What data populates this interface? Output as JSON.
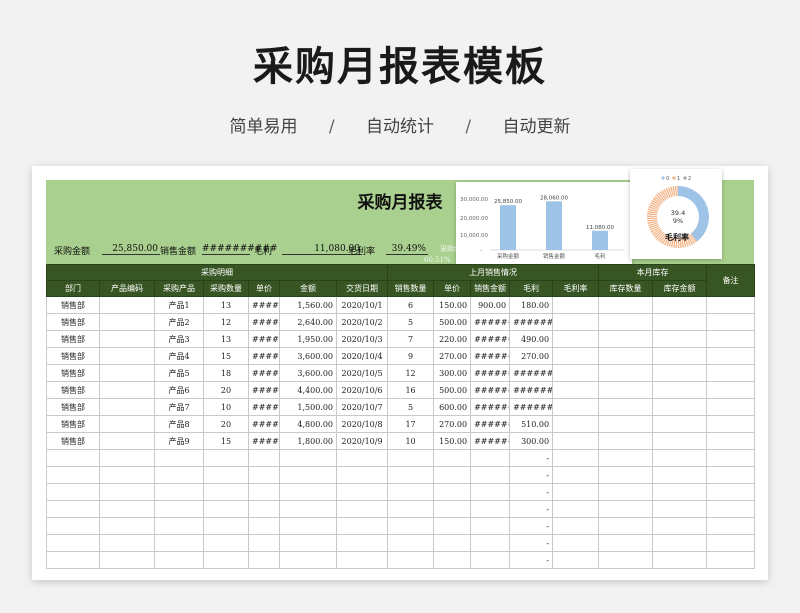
{
  "page": {
    "title": "采购月报表模板",
    "tags": [
      "简单易用",
      "自动统计",
      "自动更新"
    ],
    "separator": "/"
  },
  "sheet": {
    "title": "采购月报表",
    "summary": {
      "purchase_label": "采购金额",
      "purchase_value": "25,850.00",
      "sales_label": "销售金额",
      "sales_value": "##########",
      "profit_label": "毛利",
      "profit_value": "11,080.00",
      "margin_label": "毛利率",
      "margin_value": "39.49%",
      "partial_label": "采购金",
      "partial_value": "60.51%"
    },
    "group_headers": {
      "detail": "采购明细",
      "last_month": "上月销售情况",
      "stock": "本月库存",
      "remark": "备注"
    },
    "columns": [
      "部门",
      "产品编码",
      "采购产品",
      "采购数量",
      "单价",
      "金额",
      "交货日期",
      "销售数量",
      "单价",
      "销售金额",
      "毛利",
      "毛利率",
      "库存数量",
      "库存金额"
    ],
    "rows": [
      [
        "销售部",
        "",
        "产品1",
        "13",
        "######",
        "1,560.00",
        "2020/10/1",
        "6",
        "150.00",
        "900.00",
        "180.00",
        "",
        "",
        ""
      ],
      [
        "销售部",
        "",
        "产品2",
        "12",
        "######",
        "2,640.00",
        "2020/10/2",
        "5",
        "500.00",
        "########",
        "#########",
        "",
        "",
        ""
      ],
      [
        "销售部",
        "",
        "产品3",
        "13",
        "######",
        "1,950.00",
        "2020/10/3",
        "7",
        "220.00",
        "########",
        "490.00",
        "",
        "",
        ""
      ],
      [
        "销售部",
        "",
        "产品4",
        "15",
        "######",
        "3,600.00",
        "2020/10/4",
        "9",
        "270.00",
        "########",
        "270.00",
        "",
        "",
        ""
      ],
      [
        "销售部",
        "",
        "产品5",
        "18",
        "######",
        "3,600.00",
        "2020/10/5",
        "12",
        "300.00",
        "########",
        "#########",
        "",
        "",
        ""
      ],
      [
        "销售部",
        "",
        "产品6",
        "20",
        "######",
        "4,400.00",
        "2020/10/6",
        "16",
        "500.00",
        "########",
        "#########",
        "",
        "",
        ""
      ],
      [
        "销售部",
        "",
        "产品7",
        "10",
        "######",
        "1,500.00",
        "2020/10/7",
        "5",
        "600.00",
        "########",
        "#########",
        "",
        "",
        ""
      ],
      [
        "销售部",
        "",
        "产品8",
        "20",
        "######",
        "4,800.00",
        "2020/10/8",
        "17",
        "270.00",
        "########",
        "510.00",
        "",
        "",
        ""
      ],
      [
        "销售部",
        "",
        "产品9",
        "15",
        "######",
        "1,800.00",
        "2020/10/9",
        "10",
        "150.00",
        "########",
        "300.00",
        "",
        "",
        ""
      ],
      [
        "",
        "",
        "",
        "",
        "",
        "",
        "",
        "",
        "",
        "",
        "-",
        "",
        "",
        ""
      ],
      [
        "",
        "",
        "",
        "",
        "",
        "",
        "",
        "",
        "",
        "",
        "-",
        "",
        "",
        ""
      ],
      [
        "",
        "",
        "",
        "",
        "",
        "",
        "",
        "",
        "",
        "",
        "-",
        "",
        "",
        ""
      ],
      [
        "",
        "",
        "",
        "",
        "",
        "",
        "",
        "",
        "",
        "",
        "-",
        "",
        "",
        ""
      ],
      [
        "",
        "",
        "",
        "",
        "",
        "",
        "",
        "",
        "",
        "",
        "-",
        "",
        "",
        ""
      ],
      [
        "",
        "",
        "",
        "",
        "",
        "",
        "",
        "",
        "",
        "",
        "-",
        "",
        "",
        ""
      ],
      [
        "",
        "",
        "",
        "",
        "",
        "",
        "",
        "",
        "",
        "",
        "-",
        "",
        "",
        ""
      ]
    ]
  },
  "chart_data": [
    {
      "type": "bar",
      "categories": [
        "采购金额",
        "销售金额",
        "毛利"
      ],
      "values": [
        25850,
        28060,
        11080
      ],
      "data_labels": [
        "25,850.00",
        "28,060.00",
        "11,080.00"
      ],
      "yticks": [
        "30,000.00",
        "20,000.00",
        "10,000.00",
        "-"
      ],
      "ylim": [
        0,
        30000
      ],
      "color": "#9dc3e6"
    },
    {
      "type": "pie",
      "title": "毛利率",
      "legend": [
        "0",
        "1",
        "2"
      ],
      "labels": [
        "39.4",
        "9%"
      ],
      "values": [
        39.49,
        60.51
      ],
      "colors": [
        "#9dc3e6",
        "#f4b183"
      ]
    }
  ]
}
